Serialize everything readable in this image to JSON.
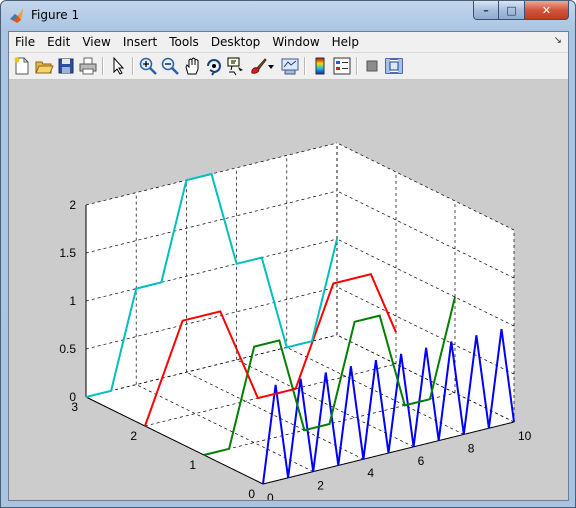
{
  "window": {
    "title": "Figure 1",
    "caption": {
      "minimize": "–",
      "maximize": "□",
      "close": "✕"
    }
  },
  "menu": {
    "items": [
      "File",
      "Edit",
      "View",
      "Insert",
      "Tools",
      "Desktop",
      "Window",
      "Help"
    ],
    "dock_icon": "dock-arrow-icon"
  },
  "toolbar": {
    "buttons": [
      "new-figure-icon",
      "open-file-icon",
      "save-icon",
      "print-icon",
      "edit-plot-arrow-icon",
      "zoom-in-icon",
      "zoom-out-icon",
      "pan-hand-icon",
      "rotate-3d-icon",
      "data-cursor-icon",
      "brush-icon",
      "brush-dropdown-icon",
      "link-plot-icon",
      "insert-colorbar-icon",
      "insert-legend-icon",
      "hide-plot-tools-icon",
      "show-plot-tools-icon"
    ]
  },
  "chart_data": {
    "type": "line",
    "view": "3d",
    "grid": true,
    "x_ticks": [
      "0",
      "2",
      "4",
      "6",
      "8",
      "10"
    ],
    "y_ticks": [
      "0",
      "1",
      "2",
      "3"
    ],
    "z_ticks": [
      "0",
      "0.5",
      "1",
      "1.5",
      "2"
    ],
    "xlim": [
      0,
      10
    ],
    "ylim": [
      0,
      3
    ],
    "zlim": [
      0,
      2
    ],
    "series": [
      {
        "color": "#0000ff",
        "y": 0,
        "points": [
          [
            0,
            0
          ],
          [
            0.5,
            1
          ],
          [
            1,
            0
          ],
          [
            1.5,
            1
          ],
          [
            2,
            0
          ],
          [
            2.5,
            1
          ],
          [
            3,
            0
          ],
          [
            3.5,
            1
          ],
          [
            4,
            0
          ],
          [
            4.5,
            1
          ],
          [
            5,
            0
          ],
          [
            5.5,
            1
          ],
          [
            6,
            0
          ],
          [
            6.5,
            1
          ],
          [
            7,
            0
          ],
          [
            7.5,
            1
          ],
          [
            8,
            0
          ],
          [
            8.5,
            1
          ],
          [
            9,
            0
          ],
          [
            9.5,
            1
          ],
          [
            10,
            0
          ]
        ]
      },
      {
        "color": "#007f00",
        "y": 1,
        "points": [
          [
            0,
            0
          ],
          [
            1,
            0
          ],
          [
            2,
            1
          ],
          [
            3,
            1
          ],
          [
            4,
            0
          ],
          [
            5,
            0
          ],
          [
            6,
            1
          ],
          [
            7,
            1
          ],
          [
            8,
            0
          ],
          [
            9,
            0
          ],
          [
            10,
            1
          ]
        ]
      },
      {
        "color": "#ff0000",
        "y": 2,
        "points": [
          [
            0,
            0
          ],
          [
            1.5,
            1
          ],
          [
            3,
            1
          ],
          [
            4.5,
            0
          ],
          [
            6,
            0
          ],
          [
            7.5,
            1
          ],
          [
            9,
            1
          ],
          [
            10,
            0.33
          ]
        ]
      },
      {
        "color": "#00bfbf",
        "y": 3,
        "points": [
          [
            0,
            0
          ],
          [
            1,
            0
          ],
          [
            2,
            1
          ],
          [
            3,
            1
          ],
          [
            4,
            2
          ],
          [
            5,
            2
          ],
          [
            6,
            1
          ],
          [
            7,
            1
          ],
          [
            8,
            0
          ],
          [
            9,
            0
          ],
          [
            10,
            1
          ]
        ]
      }
    ]
  }
}
